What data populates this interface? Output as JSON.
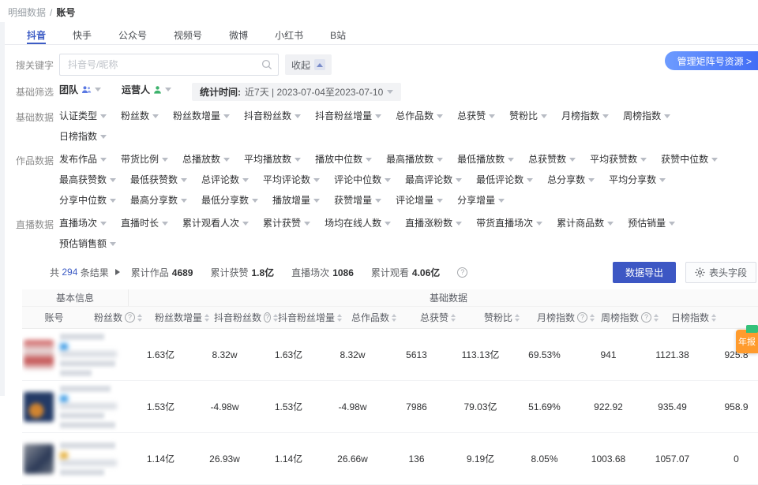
{
  "breadcrumb": {
    "parent": "明细数据",
    "separator": "/",
    "current": "账号"
  },
  "tabs": {
    "active_index": 0,
    "items": [
      "抖音",
      "快手",
      "公众号",
      "视频号",
      "微博",
      "小红书",
      "B站"
    ]
  },
  "search": {
    "label": "搜关键字",
    "placeholder": "抖音号/昵称",
    "collapse_label": "收起"
  },
  "manage_button_label": "管理矩阵号资源 >",
  "filters": {
    "basic_label": "基础筛选",
    "team_label": "团队",
    "operator_label": "运营人",
    "time_label": "统计时间:",
    "time_value": "近7天 | 2023-07-04至2023-07-10",
    "groups": [
      {
        "label": "基础数据",
        "items": [
          "认证类型",
          "粉丝数",
          "粉丝数增量",
          "抖音粉丝数",
          "抖音粉丝增量",
          "总作品数",
          "总获赞",
          "赞粉比",
          "月榜指数",
          "周榜指数",
          "日榜指数"
        ]
      },
      {
        "label": "作品数据",
        "items": [
          "发布作品",
          "带货比例",
          "总播放数",
          "平均播放数",
          "播放中位数",
          "最高播放数",
          "最低播放数",
          "总获赞数",
          "平均获赞数",
          "获赞中位数",
          "最高获赞数",
          "最低获赞数",
          "总评论数",
          "平均评论数",
          "评论中位数",
          "最高评论数",
          "最低评论数",
          "总分享数",
          "平均分享数",
          "分享中位数",
          "最高分享数",
          "最低分享数",
          "播放增量",
          "获赞增量",
          "评论增量",
          "分享增量"
        ]
      },
      {
        "label": "直播数据",
        "items": [
          "直播场次",
          "直播时长",
          "累计观看人次",
          "累计获赞",
          "场均在线人数",
          "直播涨粉数",
          "带货直播场次",
          "累计商品数",
          "预估销量",
          "预估销售额"
        ]
      }
    ]
  },
  "summary": {
    "total_prefix": "共",
    "total_count": "294",
    "total_suffix": "条结果",
    "stats": [
      {
        "label": "累计作品",
        "value": "4689"
      },
      {
        "label": "累计获赞",
        "value": "1.8亿"
      },
      {
        "label": "直播场次",
        "value": "1086"
      },
      {
        "label": "累计观看",
        "value": "4.06亿"
      }
    ],
    "export_label": "数据导出",
    "fields_label": "表头字段"
  },
  "table": {
    "group_headers": {
      "left": "基本信息",
      "right": "基础数据"
    },
    "columns": [
      {
        "label": "账号",
        "info": false,
        "sort": false
      },
      {
        "label": "粉丝数",
        "info": true,
        "sort": true
      },
      {
        "label": "粉丝数增量",
        "info": false,
        "sort": true
      },
      {
        "label": "抖音粉丝数",
        "info": true,
        "sort": true
      },
      {
        "label": "抖音粉丝增量",
        "info": false,
        "sort": true
      },
      {
        "label": "总作品数",
        "info": false,
        "sort": true
      },
      {
        "label": "总获赞",
        "info": false,
        "sort": true
      },
      {
        "label": "赞粉比",
        "info": false,
        "sort": true
      },
      {
        "label": "月榜指数",
        "info": true,
        "sort": true
      },
      {
        "label": "周榜指数",
        "info": true,
        "sort": true
      },
      {
        "label": "日榜指数",
        "info": false,
        "sort": true
      }
    ],
    "rows": [
      {
        "values": [
          "1.63亿",
          "8.32w",
          "1.63亿",
          "8.32w",
          "5613",
          "113.13亿",
          "69.53%",
          "941",
          "1121.38",
          "925.8"
        ]
      },
      {
        "values": [
          "1.53亿",
          "-4.98w",
          "1.53亿",
          "-4.98w",
          "7986",
          "79.03亿",
          "51.69%",
          "922.92",
          "935.49",
          "958.9"
        ]
      },
      {
        "values": [
          "1.14亿",
          "26.93w",
          "1.14亿",
          "26.66w",
          "136",
          "9.19亿",
          "8.05%",
          "1003.68",
          "1057.07",
          "0"
        ]
      }
    ]
  },
  "floating_badge": {
    "text": "年报"
  },
  "colors": {
    "accent_blue": "#3d5cc5",
    "export_button": "#3d57c4",
    "manage_gradient_start": "#6d9bff",
    "manage_gradient_end": "#3f6bf5",
    "badge_orange": "#ff9b2d",
    "badge_tag_green": "#34c17a",
    "team_icon_blue": "#5b79e3",
    "operator_icon_green": "#3db26c"
  }
}
